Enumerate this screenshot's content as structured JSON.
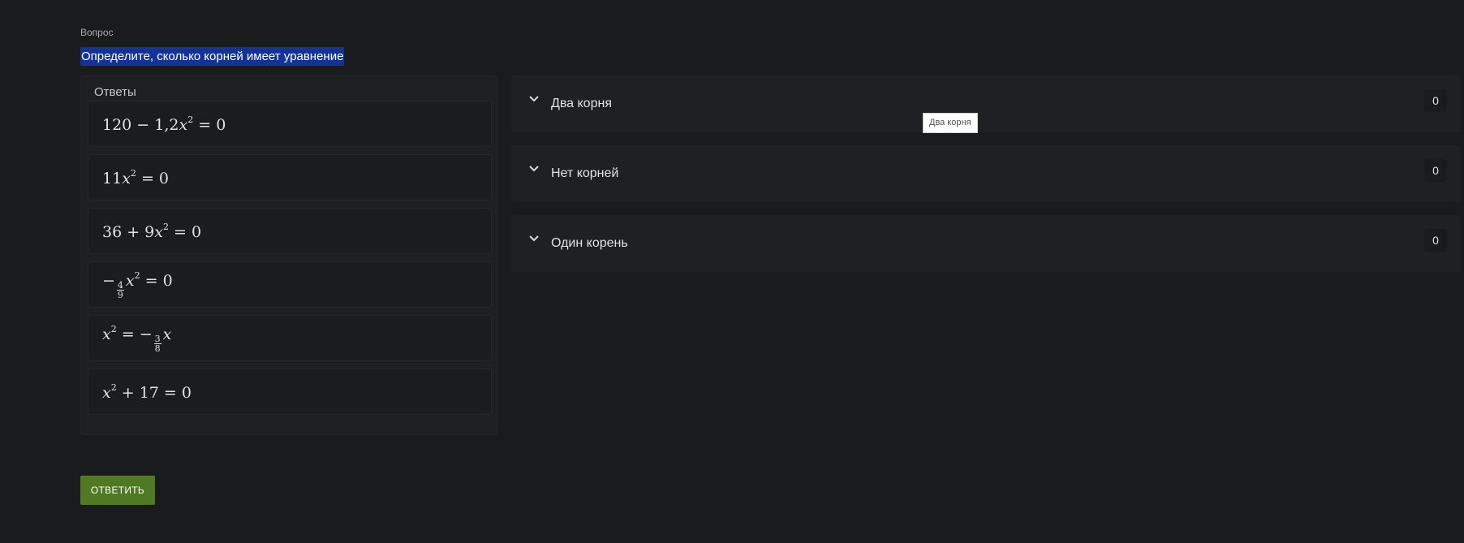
{
  "question": {
    "caption": "Вопрос",
    "title": "Определите, сколько корней имеет уравнение"
  },
  "answers": {
    "title": "Ответы",
    "items": [
      {
        "a": "120 − 1,2",
        "v": "x",
        "p": "2",
        "b": " = 0"
      },
      {
        "a": "11",
        "v": "x",
        "p": "2",
        "b": " = 0"
      },
      {
        "a": "36 + 9",
        "v": "x",
        "p": "2",
        "b": " = 0"
      },
      {
        "a": "−",
        "num": "4",
        "den": "9",
        "v": "x",
        "p": "2",
        "b": " = 0"
      },
      {
        "a": "",
        "v": "x",
        "p": "2",
        "mid": " = −",
        "num": "3",
        "den": "8",
        "v2": "x"
      },
      {
        "a": "",
        "v": "x",
        "p": "2",
        "b": " + 17 = 0"
      }
    ]
  },
  "groups": [
    {
      "label": "Два корня",
      "count": "0"
    },
    {
      "label": "Нет корней",
      "count": "0"
    },
    {
      "label": "Один корень",
      "count": "0"
    }
  ],
  "tooltip": "Два корня",
  "submit_label": "ОТВЕТИТЬ",
  "colors": {
    "background": "#1a1b1d",
    "highlight": "#12349a",
    "submit": "#4f7a23"
  }
}
